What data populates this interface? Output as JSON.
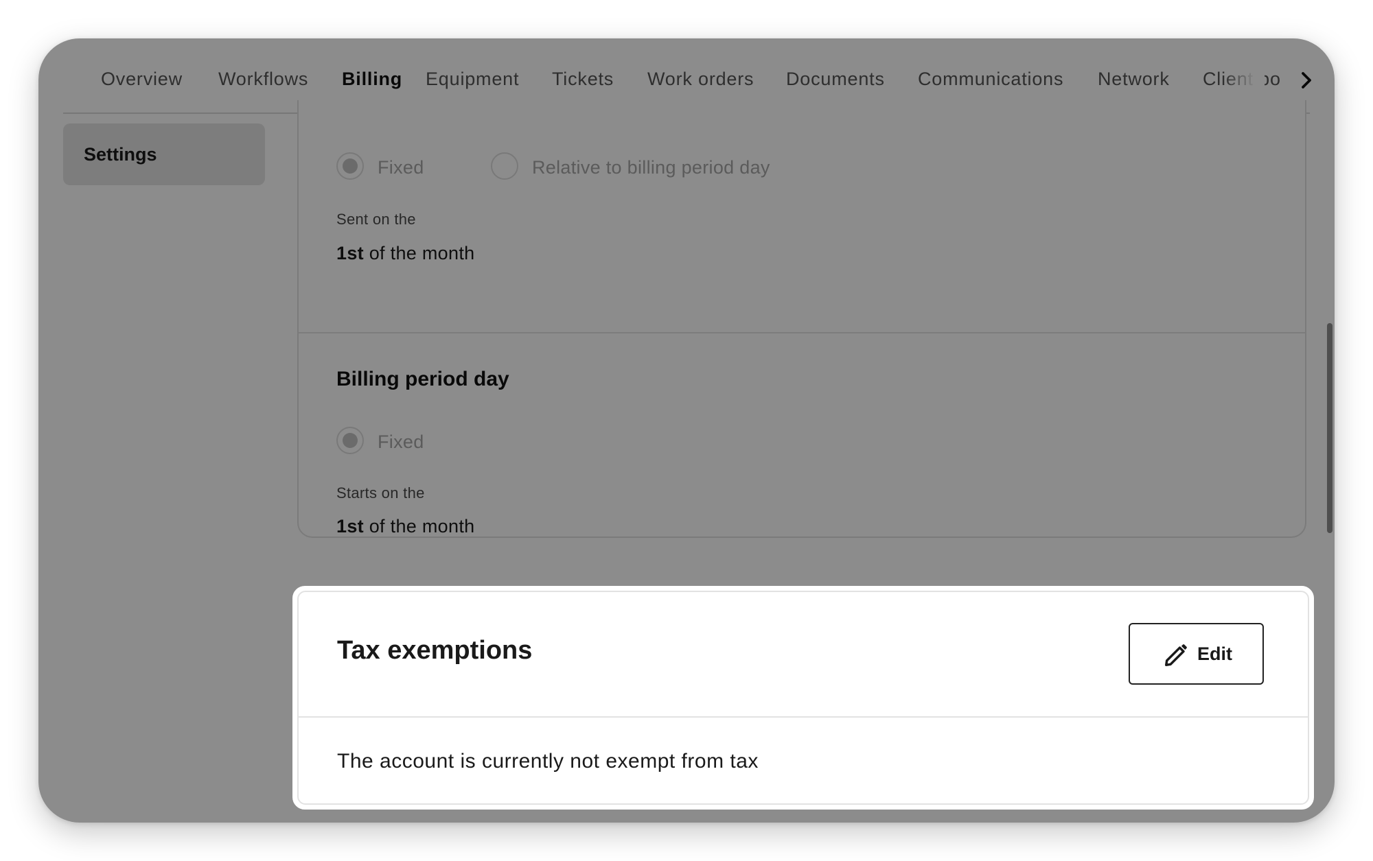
{
  "tabs": [
    {
      "label": "Overview",
      "active": false
    },
    {
      "label": "Workflows",
      "active": false
    },
    {
      "label": "Billing",
      "active": true
    },
    {
      "label": "Equipment",
      "active": false
    },
    {
      "label": "Tickets",
      "active": false
    },
    {
      "label": "Work orders",
      "active": false
    },
    {
      "label": "Documents",
      "active": false
    },
    {
      "label": "Communications",
      "active": false
    },
    {
      "label": "Network",
      "active": false
    },
    {
      "label": "Client po",
      "active": false
    }
  ],
  "tabs_next_icon": "chevron-right-icon",
  "sidebar": {
    "items": [
      {
        "label": "Settings",
        "selected": true
      }
    ]
  },
  "invoice_send_day": {
    "options": [
      {
        "label": "Fixed",
        "checked": true
      },
      {
        "label": "Relative to billing period day",
        "checked": false
      }
    ],
    "value_label": "Sent on the",
    "value_bold": "1st",
    "value_rest": " of the month"
  },
  "billing_period_day": {
    "heading": "Billing period day",
    "options": [
      {
        "label": "Fixed",
        "checked": true
      }
    ],
    "value_label": "Starts on the",
    "value_bold": "1st",
    "value_rest": " of the month"
  },
  "tax_exemptions": {
    "title": "Tax exemptions",
    "edit_label": "Edit",
    "edit_icon": "pencil-icon",
    "status": "The account is currently not exempt from tax"
  },
  "colors": {
    "overlay": "#000000",
    "accent": "#1a1a1a",
    "sidebar_selected": "#e4e4e4"
  }
}
